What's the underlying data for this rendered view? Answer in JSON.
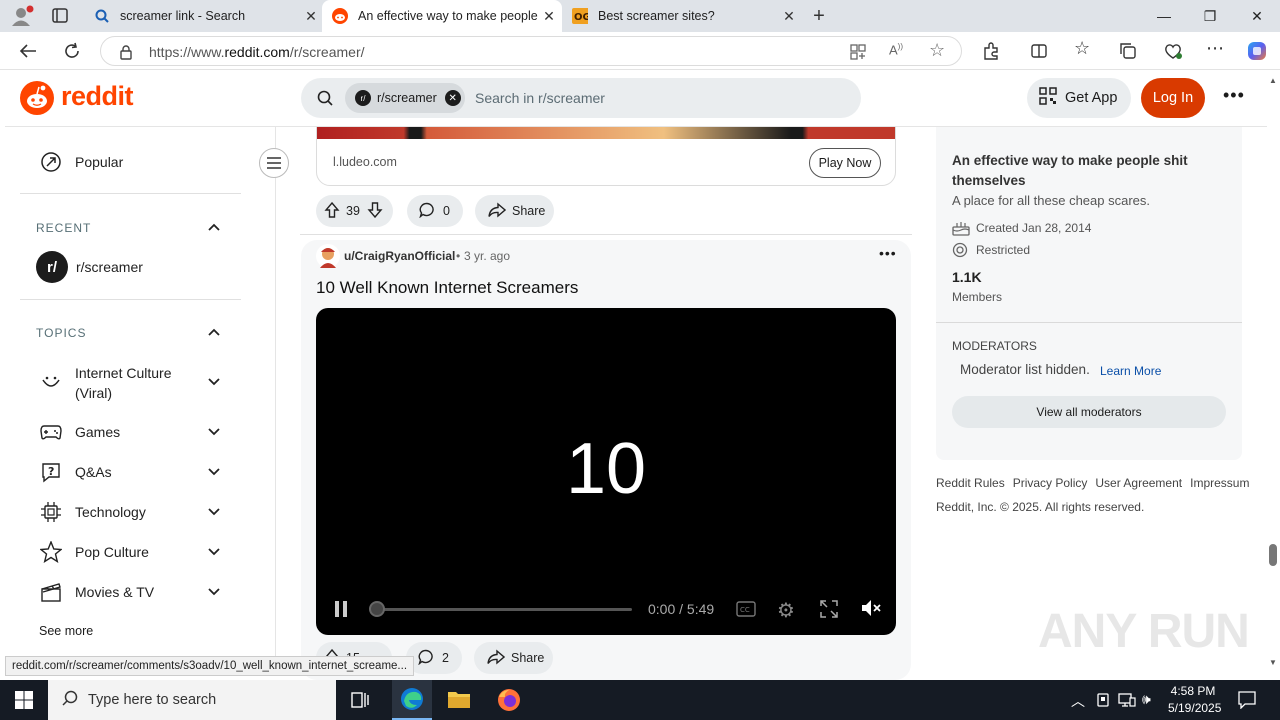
{
  "browser": {
    "tabs": [
      {
        "title": "screamer link - Search",
        "icon": "bing-search-icon",
        "active": false
      },
      {
        "title": "An effective way to make people",
        "icon": "reddit-icon",
        "active": true
      },
      {
        "title": "Best screamer sites?",
        "icon": "og-icon",
        "active": false
      }
    ],
    "url_prefix": "https://www.",
    "url_domain": "reddit.com",
    "url_path": "/r/screamer/",
    "status_url": "reddit.com/r/screamer/comments/s3oadv/10_well_known_internet_screame..."
  },
  "header": {
    "logo": "reddit",
    "search_chip": "r/screamer",
    "search_placeholder": "Search in r/screamer",
    "get_app": "Get App",
    "login": "Log In"
  },
  "sidebar": {
    "popular": "Popular",
    "recent_heading": "RECENT",
    "recent_item": "r/screamer",
    "recent_icon_text": "r/",
    "topics_heading": "TOPICS",
    "topics": [
      {
        "label": "Internet Culture (Viral)",
        "icon": "smile-icon"
      },
      {
        "label": "Games",
        "icon": "gamepad-icon"
      },
      {
        "label": "Q&As",
        "icon": "question-icon"
      },
      {
        "label": "Technology",
        "icon": "chip-icon"
      },
      {
        "label": "Pop Culture",
        "icon": "star-icon"
      },
      {
        "label": "Movies & TV",
        "icon": "clapper-icon"
      }
    ],
    "see_more": "See more"
  },
  "ad": {
    "domain": "l.ludeo.com",
    "cta": "Play Now",
    "upvotes": "39",
    "comments": "0",
    "share": "Share"
  },
  "post": {
    "author": "u/CraigRyanOfficial",
    "age": "3 yr. ago",
    "title": "10 Well Known Internet Screamers",
    "video_text": "10",
    "time": "0:00 / 5:49",
    "progress": 0,
    "upvotes_partial": "15",
    "comments": "2",
    "share": "Share"
  },
  "community": {
    "title": "An effective way to make people shit themselves",
    "description": "A place for all these cheap scares.",
    "created": "Created Jan 28, 2014",
    "status": "Restricted",
    "members_count": "1.1K",
    "members_label": "Members",
    "moderators_heading": "MODERATORS",
    "moderators_hidden": "Moderator list hidden.",
    "learn_more": "Learn More",
    "view_all": "View all moderators"
  },
  "footer": {
    "links": [
      "Reddit Rules",
      "Privacy Policy",
      "User Agreement",
      "Impressum"
    ],
    "copyright": "Reddit, Inc. © 2025. All rights reserved."
  },
  "taskbar": {
    "search_placeholder": "Type here to search",
    "time": "4:58 PM",
    "date": "5/19/2025"
  },
  "watermark": "ANY RUN",
  "colors": {
    "reddit_orange": "#ff4500",
    "login_bg": "#d93a00",
    "link_blue": "#0a4fa8"
  }
}
